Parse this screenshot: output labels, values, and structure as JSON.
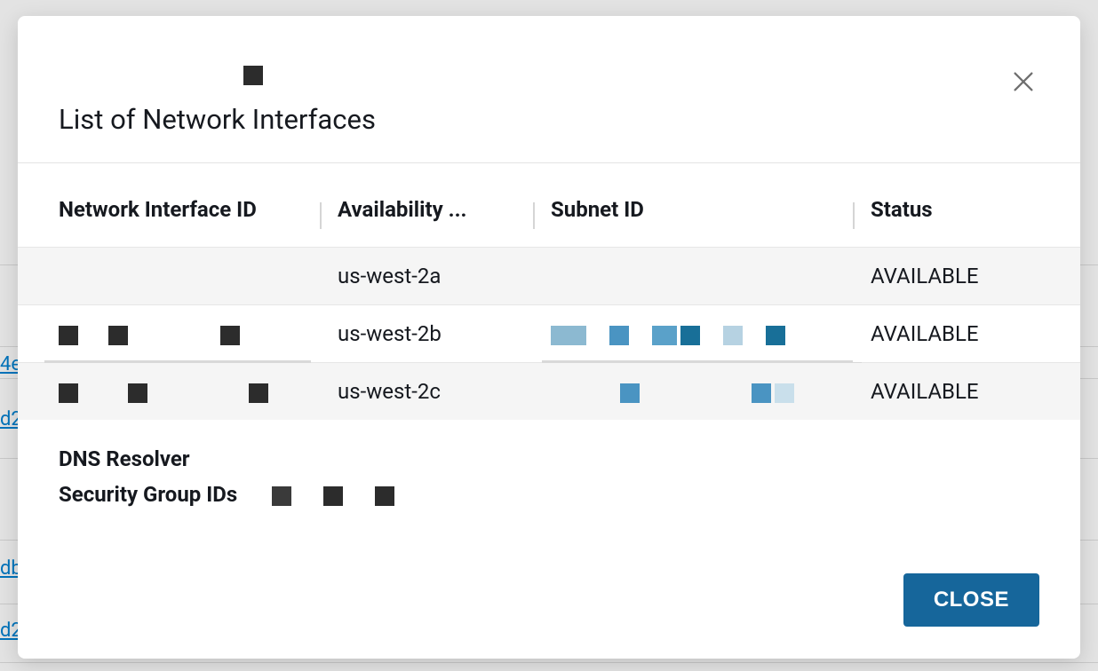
{
  "modal": {
    "title": "List of Network Interfaces",
    "close_button_label": "CLOSE"
  },
  "table": {
    "headers": {
      "nii": "Network Interface ID",
      "az": "Availability ...",
      "subnet": "Subnet ID",
      "status": "Status"
    },
    "rows": [
      {
        "az": "us-west-2a",
        "status": "AVAILABLE"
      },
      {
        "az": "us-west-2b",
        "status": "AVAILABLE"
      },
      {
        "az": "us-west-2c",
        "status": "AVAILABLE"
      }
    ]
  },
  "details": {
    "dns_label": "DNS Resolver",
    "sg_label": "Security Group IDs"
  },
  "bg_links": [
    "4e",
    "d2",
    "db",
    "d2"
  ],
  "colors": {
    "blue1": "#8cb9d1",
    "blue2": "#4a94c2",
    "blue3": "#186f98",
    "blue4": "#b6d2e2"
  }
}
